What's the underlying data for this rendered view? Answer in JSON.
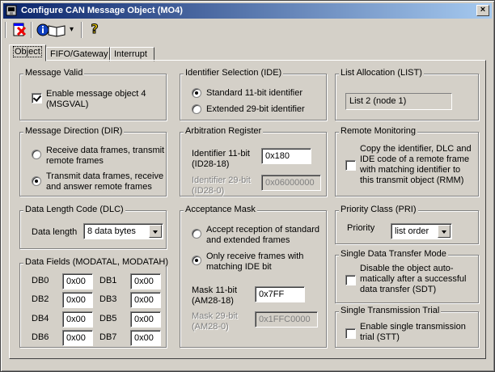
{
  "window": {
    "title": "Configure CAN Message Object (MO4)",
    "close": "×"
  },
  "toolbar": {
    "dropdown_arrow": "▾",
    "help_glyph": "?"
  },
  "tabs": [
    "Object",
    "FIFO/Gateway",
    "Interrupt"
  ],
  "msg_valid": {
    "legend": "Message Valid",
    "label": "Enable message object 4\n(MSGVAL)",
    "checked": true
  },
  "dir": {
    "legend": "Message Direction (DIR)",
    "opt1": "Receive data frames, transmit\nremote frames",
    "opt2": "Transmit data frames, receive\nand answer remote frames"
  },
  "dlc": {
    "legend": "Data Length Code (DLC)",
    "label": "Data length",
    "value": "8 data bytes"
  },
  "fields": {
    "legend": "Data Fields (MODATAL, MODATAH)",
    "items": [
      {
        "label": "DB0",
        "value": "0x00"
      },
      {
        "label": "DB1",
        "value": "0x00"
      },
      {
        "label": "DB2",
        "value": "0x00"
      },
      {
        "label": "DB3",
        "value": "0x00"
      },
      {
        "label": "DB4",
        "value": "0x00"
      },
      {
        "label": "DB5",
        "value": "0x00"
      },
      {
        "label": "DB6",
        "value": "0x00"
      },
      {
        "label": "DB7",
        "value": "0x00"
      }
    ]
  },
  "ide": {
    "legend": "Identifier Selection (IDE)",
    "opt1": "Standard 11-bit identifier",
    "opt2": "Extended 29-bit identifier"
  },
  "arb": {
    "legend": "Arbitration Register",
    "id11_label": "Identifier 11-bit\n(ID28-18)",
    "id11_value": "0x180",
    "id29_label": "Identifier 29-bit\n(ID28-0)",
    "id29_value": "0x06000000"
  },
  "mask": {
    "legend": "Acceptance Mask",
    "opt1": "Accept reception of standard\nand extended frames",
    "opt2": "Only receive frames with\nmatching IDE bit",
    "m11_label": "Mask 11-bit\n(AM28-18)",
    "m11_value": "0x7FF",
    "m29_label": "Mask 29-bit\n(AM28-0)",
    "m29_value": "0x1FFC0000"
  },
  "list": {
    "legend": "List Allocation (LIST)",
    "value": "List 2 (node 1)"
  },
  "remote": {
    "legend": "Remote Monitoring",
    "label": "Copy the identifier, DLC and\nIDE code of a remote frame\nwith matching identifier to\nthis transmit object (RMM)"
  },
  "prio": {
    "legend": "Priority Class (PRI)",
    "label": "Priority",
    "value": "list order"
  },
  "sdt": {
    "legend": "Single Data Transfer Mode",
    "label": "Disable the object auto-\nmatically after a successful\ndata transfer (SDT)"
  },
  "stt": {
    "legend": "Single Transmission Trial",
    "label": "Enable single transmission\ntrial (STT)"
  }
}
